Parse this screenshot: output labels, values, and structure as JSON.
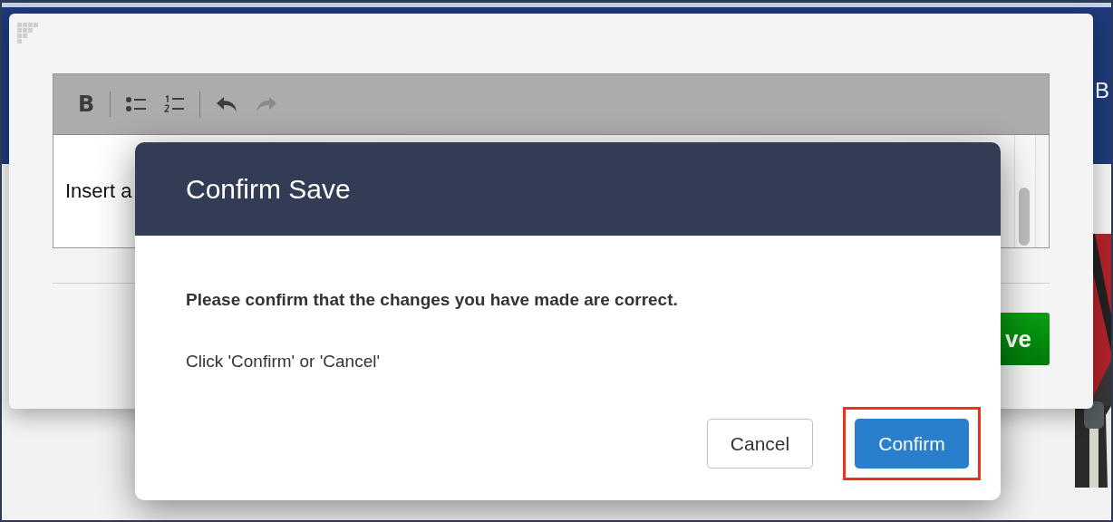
{
  "background_page": {
    "header_text": "B",
    "kind": "picture"
  },
  "editor_window": {
    "toolbar": [
      {
        "kind": "bold",
        "label": "B",
        "disabled": false
      },
      {
        "kind": "separator"
      },
      {
        "kind": "bullets",
        "disabled": false
      },
      {
        "kind": "numbers",
        "disabled": false
      },
      {
        "kind": "separator"
      },
      {
        "kind": "undo",
        "disabled": false
      },
      {
        "kind": "redo",
        "disabled": true
      }
    ],
    "content_text": "Insert a",
    "save_button": "ve"
  },
  "dialog": {
    "title": "Confirm Save",
    "message": "Please confirm that the changes you have made are correct.",
    "instruction": "Click 'Confirm' or 'Cancel'",
    "buttons": [
      {
        "label": "Cancel",
        "kind": "secondary",
        "highlighted": false
      },
      {
        "label": "Confirm",
        "kind": "primary",
        "highlighted": true
      }
    ]
  }
}
